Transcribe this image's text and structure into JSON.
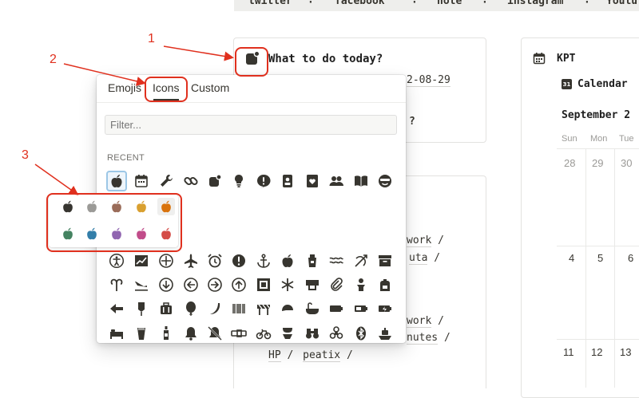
{
  "topbar": {
    "links": [
      "twitter",
      "facebook",
      "note",
      "instagram",
      "Youtu"
    ],
    "separator": "·"
  },
  "main_page": {
    "title": "What to do today?",
    "date_text": "2-08-29",
    "question_mark": "?"
  },
  "second_card": {
    "link_rows": [
      {
        "a": "work",
        "b": " /"
      },
      {
        "a": "uta",
        "b": " /"
      },
      {
        "a": "work",
        "b": " /"
      },
      {
        "a": "nutes",
        "b": " /"
      }
    ],
    "hp": "HP",
    "peatix": "peatix",
    "slash": "/"
  },
  "kpt": {
    "title": "KPT",
    "calendar_title": "Calendar",
    "calendar_icon_text": "31",
    "month": "September 2",
    "weekdays": [
      "Sun",
      "Mon",
      "Tue"
    ],
    "week1": [
      "28",
      "29",
      "30"
    ],
    "week2": [
      "4",
      "5",
      "6"
    ],
    "week3": [
      "11",
      "12",
      "13"
    ]
  },
  "picker": {
    "tabs": [
      "Emojis",
      "Icons",
      "Custom"
    ],
    "active_tab": "Icons",
    "filter_placeholder": "Filter...",
    "section_label": "RECENT",
    "recent_icons": [
      "apple-icon",
      "calendar-icon",
      "wrench-icon",
      "link-icon",
      "notification-icon",
      "lightbulb-icon",
      "exclamation-bubble-icon",
      "id-badge-icon",
      "heart-card-icon",
      "people-icon",
      "book-icon",
      "smiley-glasses-icon"
    ],
    "icon_rows": [
      [
        "accessibility-icon",
        "chart-icon",
        "plus-circle-icon",
        "airplane-icon",
        "alarm-clock-icon",
        "alert-icon",
        "anchor-icon",
        "apple-icon",
        "apron-icon",
        "waves-icon",
        "archery-icon",
        "archive-icon"
      ],
      [
        "aries-icon",
        "arrival-icon",
        "arrow-down-circle-icon",
        "arrow-left-circle-icon",
        "arrow-right-circle-icon",
        "arrow-up-circle-icon",
        "artwork-icon",
        "asterisk-icon",
        "atm-icon",
        "attachment-icon",
        "baby-icon",
        "backpack-icon"
      ],
      [
        "back-arrow-icon",
        "bag-drip-icon",
        "baggage-icon",
        "balloon-icon",
        "banana-icon",
        "barcode-icon",
        "barrier-icon",
        "baseball-cap-icon",
        "bathtub-icon",
        "battery-icon",
        "battery-half-icon",
        "battery-charging-icon"
      ],
      [
        "bed-icon",
        "beer-icon",
        "bottle-icon",
        "bell-icon",
        "bell-off-icon",
        "belt-icon",
        "bicycle-icon",
        "bikini-icon",
        "binoculars-icon",
        "biohazard-icon",
        "bluetooth-icon",
        "boat-icon"
      ]
    ],
    "swatch_colors": [
      "#373530",
      "#9b9a97",
      "#9a6c59",
      "#d9a030",
      "#d9730d",
      "#448361",
      "#337ea9",
      "#9065b0",
      "#c14c8a",
      "#d44c47"
    ]
  },
  "annotations": {
    "labels": [
      "1",
      "2",
      "3"
    ],
    "color": "#e0301e"
  }
}
